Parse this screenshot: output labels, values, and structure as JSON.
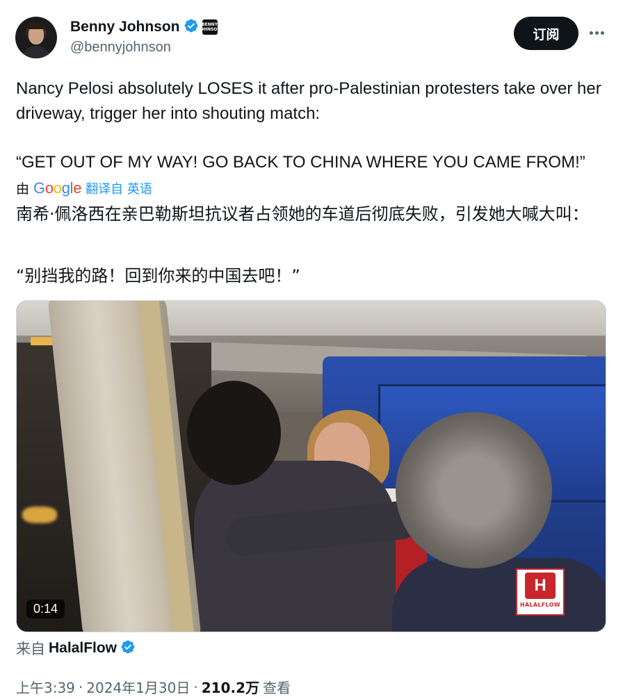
{
  "author": {
    "display_name": "Benny Johnson",
    "handle": "@bennyjohnson",
    "affiliate_badge_text": "BENNY JOHNSON"
  },
  "header": {
    "subscribe_label": "订阅",
    "more_icon": "more-horizontal-icon"
  },
  "tweet": {
    "text": "Nancy Pelosi absolutely LOSES it after pro-Palestinian protesters take over her driveway, trigger her into shouting match:",
    "quote": "“GET OUT OF MY WAY! GO BACK TO CHINA WHERE YOU CAME FROM!”"
  },
  "translation": {
    "by_label": "由",
    "provider": "Google",
    "link_text": "翻译自 英语",
    "text": "南希·佩洛西在亲巴勒斯坦抗议者占领她的车道后彻底失败，引发她大喊大叫：",
    "quote": "“别挡我的路！回到你来的中国去吧！”"
  },
  "media": {
    "duration": "0:14",
    "watermark_text": "HALALFLOW"
  },
  "source": {
    "label": "来自",
    "name": "HalalFlow"
  },
  "meta": {
    "time": "上午3:39",
    "separator": "·",
    "date": "2024年1月30日",
    "views_count": "210.2万",
    "views_label": "查看"
  },
  "colors": {
    "verified_blue": "#1d9bf0",
    "text_primary": "#0f1419",
    "text_secondary": "#536471"
  }
}
